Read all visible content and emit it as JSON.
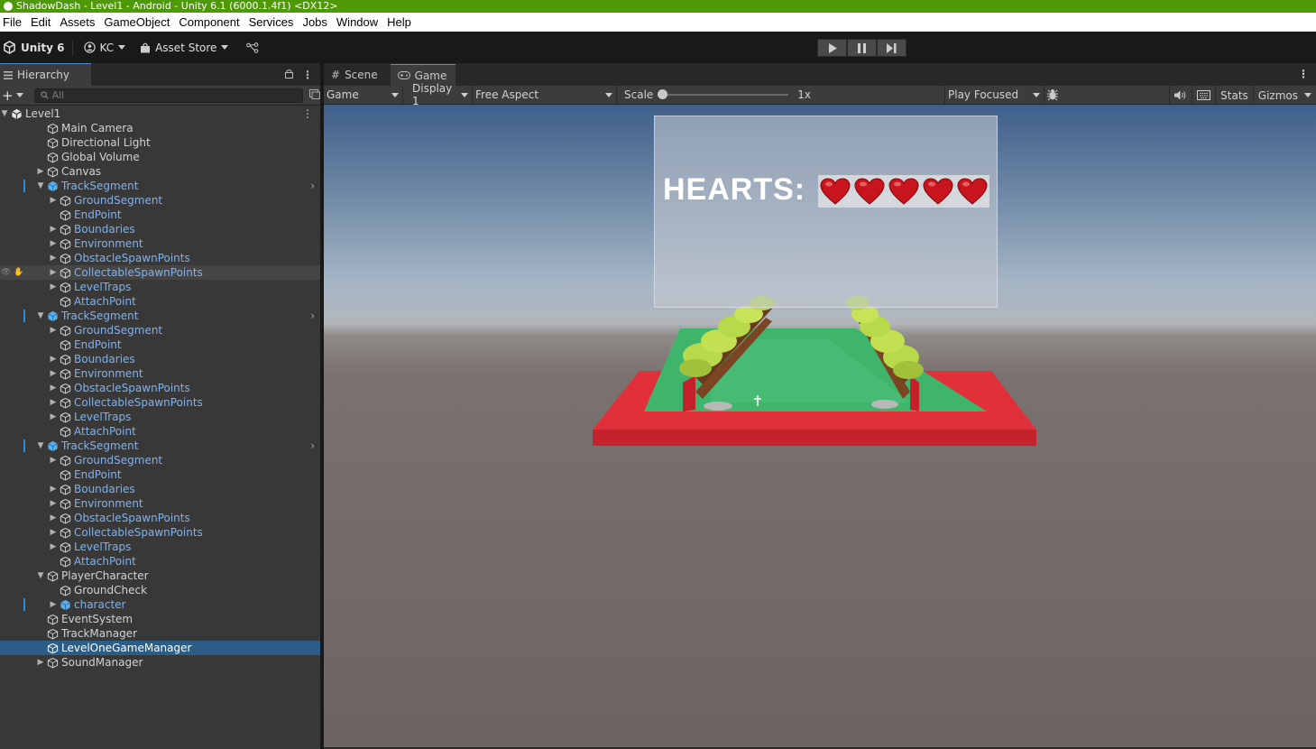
{
  "window": {
    "title": "ShadowDash - Level1 - Android - Unity 6.1 (6000.1.4f1) <DX12>"
  },
  "menu": [
    "File",
    "Edit",
    "Assets",
    "GameObject",
    "Component",
    "Services",
    "Jobs",
    "Window",
    "Help"
  ],
  "toolbar": {
    "unity_label": "Unity 6",
    "account_label": "KC",
    "asset_store_label": "Asset Store"
  },
  "hierarchy": {
    "tab_label": "Hierarchy",
    "search_placeholder": "All",
    "rows": [
      {
        "label": "Level1",
        "depth": 0,
        "arrow": "open",
        "kind": "scene"
      },
      {
        "label": "Main Camera",
        "depth": 1,
        "arrow": "",
        "kind": "object"
      },
      {
        "label": "Directional Light",
        "depth": 1,
        "arrow": "",
        "kind": "object"
      },
      {
        "label": "Global Volume",
        "depth": 1,
        "arrow": "",
        "kind": "object"
      },
      {
        "label": "Canvas",
        "depth": 1,
        "arrow": "closed",
        "kind": "object"
      },
      {
        "label": "TrackSegment",
        "depth": 1,
        "arrow": "open",
        "kind": "prefab-root"
      },
      {
        "label": "GroundSegment",
        "depth": 2,
        "arrow": "closed",
        "kind": "prefab"
      },
      {
        "label": "EndPoint",
        "depth": 2,
        "arrow": "",
        "kind": "prefab"
      },
      {
        "label": "Boundaries",
        "depth": 2,
        "arrow": "closed",
        "kind": "prefab"
      },
      {
        "label": "Environment",
        "depth": 2,
        "arrow": "closed",
        "kind": "prefab"
      },
      {
        "label": "ObstacleSpawnPoints",
        "depth": 2,
        "arrow": "closed",
        "kind": "prefab"
      },
      {
        "label": "CollectableSpawnPoints",
        "depth": 2,
        "arrow": "closed",
        "kind": "prefab",
        "hover": true
      },
      {
        "label": "LevelTraps",
        "depth": 2,
        "arrow": "closed",
        "kind": "prefab"
      },
      {
        "label": "AttachPoint",
        "depth": 2,
        "arrow": "",
        "kind": "prefab"
      },
      {
        "label": "TrackSegment",
        "depth": 1,
        "arrow": "open",
        "kind": "prefab-root"
      },
      {
        "label": "GroundSegment",
        "depth": 2,
        "arrow": "closed",
        "kind": "prefab"
      },
      {
        "label": "EndPoint",
        "depth": 2,
        "arrow": "",
        "kind": "prefab"
      },
      {
        "label": "Boundaries",
        "depth": 2,
        "arrow": "closed",
        "kind": "prefab"
      },
      {
        "label": "Environment",
        "depth": 2,
        "arrow": "closed",
        "kind": "prefab"
      },
      {
        "label": "ObstacleSpawnPoints",
        "depth": 2,
        "arrow": "closed",
        "kind": "prefab"
      },
      {
        "label": "CollectableSpawnPoints",
        "depth": 2,
        "arrow": "closed",
        "kind": "prefab"
      },
      {
        "label": "LevelTraps",
        "depth": 2,
        "arrow": "closed",
        "kind": "prefab"
      },
      {
        "label": "AttachPoint",
        "depth": 2,
        "arrow": "",
        "kind": "prefab"
      },
      {
        "label": "TrackSegment",
        "depth": 1,
        "arrow": "open",
        "kind": "prefab-root"
      },
      {
        "label": "GroundSegment",
        "depth": 2,
        "arrow": "closed",
        "kind": "prefab"
      },
      {
        "label": "EndPoint",
        "depth": 2,
        "arrow": "",
        "kind": "prefab"
      },
      {
        "label": "Boundaries",
        "depth": 2,
        "arrow": "closed",
        "kind": "prefab"
      },
      {
        "label": "Environment",
        "depth": 2,
        "arrow": "closed",
        "kind": "prefab"
      },
      {
        "label": "ObstacleSpawnPoints",
        "depth": 2,
        "arrow": "closed",
        "kind": "prefab"
      },
      {
        "label": "CollectableSpawnPoints",
        "depth": 2,
        "arrow": "closed",
        "kind": "prefab"
      },
      {
        "label": "LevelTraps",
        "depth": 2,
        "arrow": "closed",
        "kind": "prefab"
      },
      {
        "label": "AttachPoint",
        "depth": 2,
        "arrow": "",
        "kind": "prefab"
      },
      {
        "label": "PlayerCharacter",
        "depth": 1,
        "arrow": "open",
        "kind": "object"
      },
      {
        "label": "GroundCheck",
        "depth": 2,
        "arrow": "",
        "kind": "object"
      },
      {
        "label": "character",
        "depth": 2,
        "arrow": "closed",
        "kind": "prefab-root-child"
      },
      {
        "label": "EventSystem",
        "depth": 1,
        "arrow": "",
        "kind": "object"
      },
      {
        "label": "TrackManager",
        "depth": 1,
        "arrow": "",
        "kind": "object"
      },
      {
        "label": "LevelOneGameManager",
        "depth": 1,
        "arrow": "",
        "kind": "object",
        "selected": true
      },
      {
        "label": "SoundManager",
        "depth": 1,
        "arrow": "closed",
        "kind": "object"
      }
    ]
  },
  "game_view": {
    "tabs": [
      "Scene",
      "Game"
    ],
    "active_tab": "Game",
    "mode_dropdown": "Game",
    "display_dropdown": "Display 1",
    "aspect_dropdown": "Free Aspect",
    "scale_label": "Scale",
    "scale_value": "1x",
    "play_mode_dropdown": "Play Focused",
    "stats_label": "Stats",
    "gizmos_label": "Gizmos",
    "hud_text": "HEARTS:",
    "hearts_count": 5
  },
  "colors": {
    "title_bar": "#4e9a06",
    "selection": "#2c5d87",
    "prefab_text": "#7cb3f2",
    "track_red": "#e0303a",
    "track_green": "#3fb56b",
    "heart_red": "#c8141c"
  }
}
